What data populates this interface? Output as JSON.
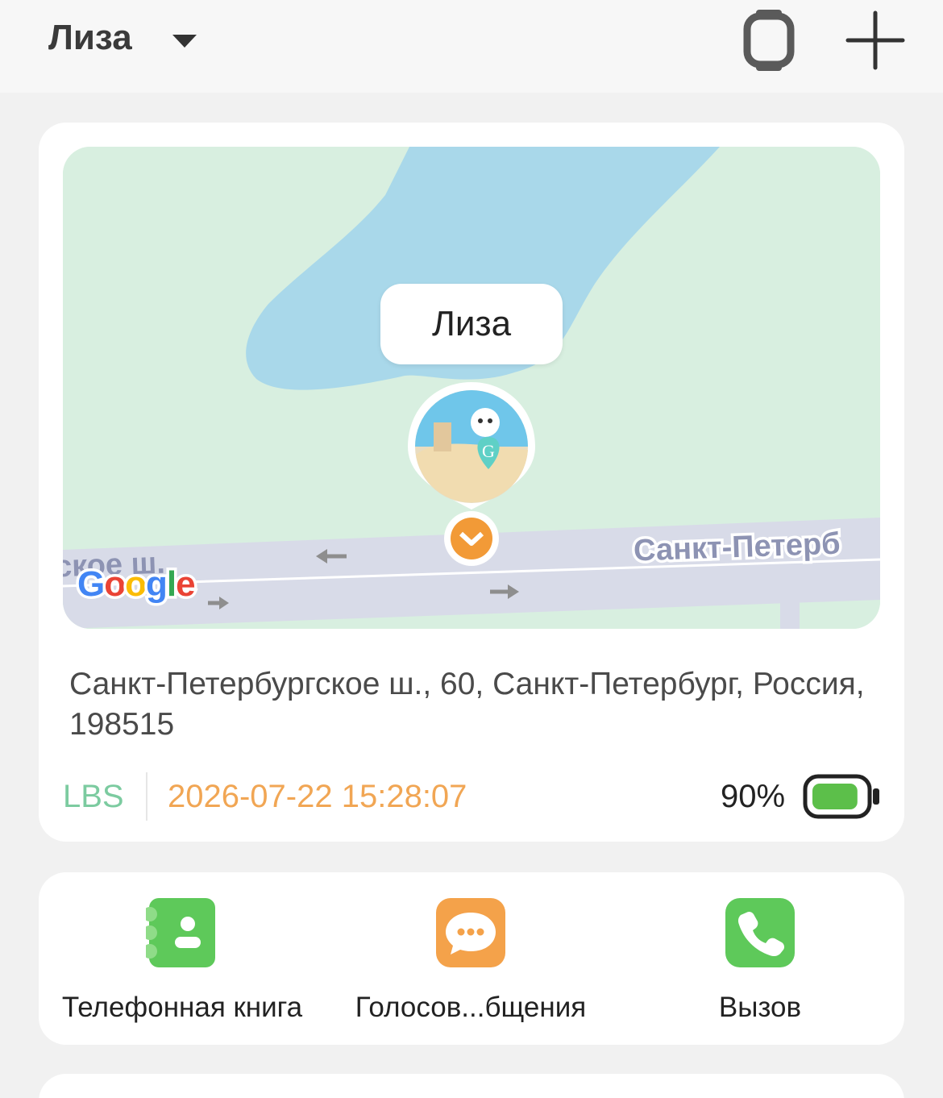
{
  "header": {
    "profile_name": "Лиза"
  },
  "map": {
    "marker_label": "Лиза",
    "street_label_right": "Санкт-Петерб",
    "street_label_left": "ское ш.",
    "provider_logo": "Google"
  },
  "location": {
    "address": "Санкт-Петербургское ш., 60, Санкт-Петербург, Россия, 198515",
    "type": "LBS",
    "timestamp": "2026-07-22 15:28:07",
    "battery": "90%",
    "battery_level": 0.9
  },
  "actions": [
    {
      "label": "Телефонная книга",
      "icon": "contacts-book-icon",
      "color": "#5ec95a"
    },
    {
      "label": "Голосов...бщения",
      "icon": "chat-bubble-icon",
      "color": "#f4a24a"
    },
    {
      "label": "Вызов",
      "icon": "phone-icon",
      "color": "#5ec95a"
    }
  ],
  "colors": {
    "accent_green": "#5ec95a",
    "accent_orange": "#f4a24a",
    "timestamp": "#f1a654",
    "lbs": "#7ccba0",
    "water": "#a9d8ea",
    "land": "#d8efe0",
    "road": "#d8dbe8"
  }
}
